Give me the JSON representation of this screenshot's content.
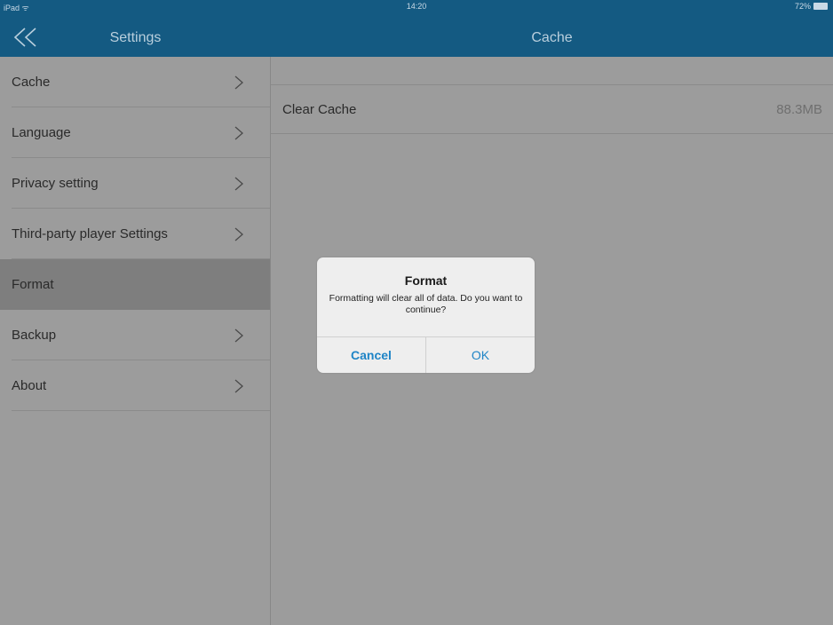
{
  "status_bar": {
    "carrier": "iPad ᯤ",
    "time": "14:20",
    "battery": "72%"
  },
  "nav": {
    "back_icon": "double-chevron-left-icon",
    "left_title": "Settings",
    "right_title": "Cache"
  },
  "sidebar": {
    "items": [
      {
        "label": "Cache",
        "chevron": true
      },
      {
        "label": "Language",
        "chevron": true
      },
      {
        "label": "Privacy setting",
        "chevron": true
      },
      {
        "label": "Third-party player Settings",
        "chevron": true
      },
      {
        "label": "Format",
        "chevron": false,
        "selected": true
      },
      {
        "label": "Backup",
        "chevron": true
      },
      {
        "label": "About",
        "chevron": true
      }
    ]
  },
  "content": {
    "rows": [
      {
        "label": "Clear Cache",
        "value": "88.3MB"
      }
    ]
  },
  "dialog": {
    "title": "Format",
    "message": "Formatting will clear all of data. Do you want to continue?",
    "cancel_label": "Cancel",
    "ok_label": "OK"
  },
  "colors": {
    "nav_bar": "#145a82",
    "overlay_bg": "#9c9c9c",
    "selected_row": "#7e7e7e",
    "dialog_button": "#1e84c6"
  }
}
